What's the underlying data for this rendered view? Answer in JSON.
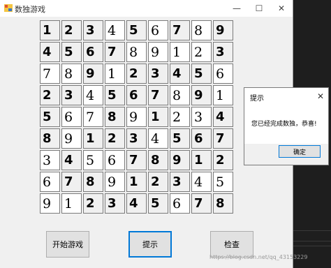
{
  "window": {
    "title": "数独游戏",
    "minimize": "—",
    "maximize": "☐",
    "close": "✕"
  },
  "board": {
    "rows": [
      [
        "1",
        "2",
        "3",
        "4",
        "5",
        "6",
        "7",
        "8",
        "9"
      ],
      [
        "4",
        "5",
        "6",
        "7",
        "8",
        "9",
        "1",
        "2",
        "3"
      ],
      [
        "7",
        "8",
        "9",
        "1",
        "2",
        "3",
        "4",
        "5",
        "6"
      ],
      [
        "2",
        "3",
        "4",
        "5",
        "6",
        "7",
        "8",
        "9",
        "1"
      ],
      [
        "5",
        "6",
        "7",
        "8",
        "9",
        "1",
        "2",
        "3",
        "4"
      ],
      [
        "8",
        "9",
        "1",
        "2",
        "3",
        "4",
        "5",
        "6",
        "7"
      ],
      [
        "3",
        "4",
        "5",
        "6",
        "7",
        "8",
        "9",
        "1",
        "2"
      ],
      [
        "6",
        "7",
        "8",
        "9",
        "1",
        "2",
        "3",
        "4",
        "5"
      ],
      [
        "9",
        "1",
        "2",
        "3",
        "4",
        "5",
        "6",
        "7",
        "8"
      ]
    ],
    "fixed_mask": [
      [
        1,
        1,
        1,
        0,
        1,
        0,
        1,
        0,
        1
      ],
      [
        1,
        1,
        1,
        1,
        0,
        0,
        0,
        0,
        1
      ],
      [
        0,
        0,
        1,
        0,
        1,
        1,
        1,
        1,
        0
      ],
      [
        1,
        1,
        0,
        1,
        1,
        1,
        0,
        1,
        0
      ],
      [
        1,
        0,
        0,
        1,
        0,
        1,
        0,
        0,
        1
      ],
      [
        1,
        0,
        1,
        1,
        1,
        0,
        1,
        1,
        1
      ],
      [
        0,
        1,
        0,
        0,
        1,
        1,
        1,
        1,
        1
      ],
      [
        0,
        1,
        1,
        0,
        1,
        1,
        1,
        0,
        0
      ],
      [
        0,
        0,
        1,
        1,
        1,
        1,
        0,
        1,
        1
      ]
    ]
  },
  "buttons": {
    "start": "开始游戏",
    "hint": "提示",
    "check": "检查"
  },
  "dialog": {
    "title": "提示",
    "message": "您已经完成数独，恭喜!",
    "ok": "确定",
    "close": "✕"
  },
  "watermark": "https://blog.csdn.net/qq_43153229"
}
